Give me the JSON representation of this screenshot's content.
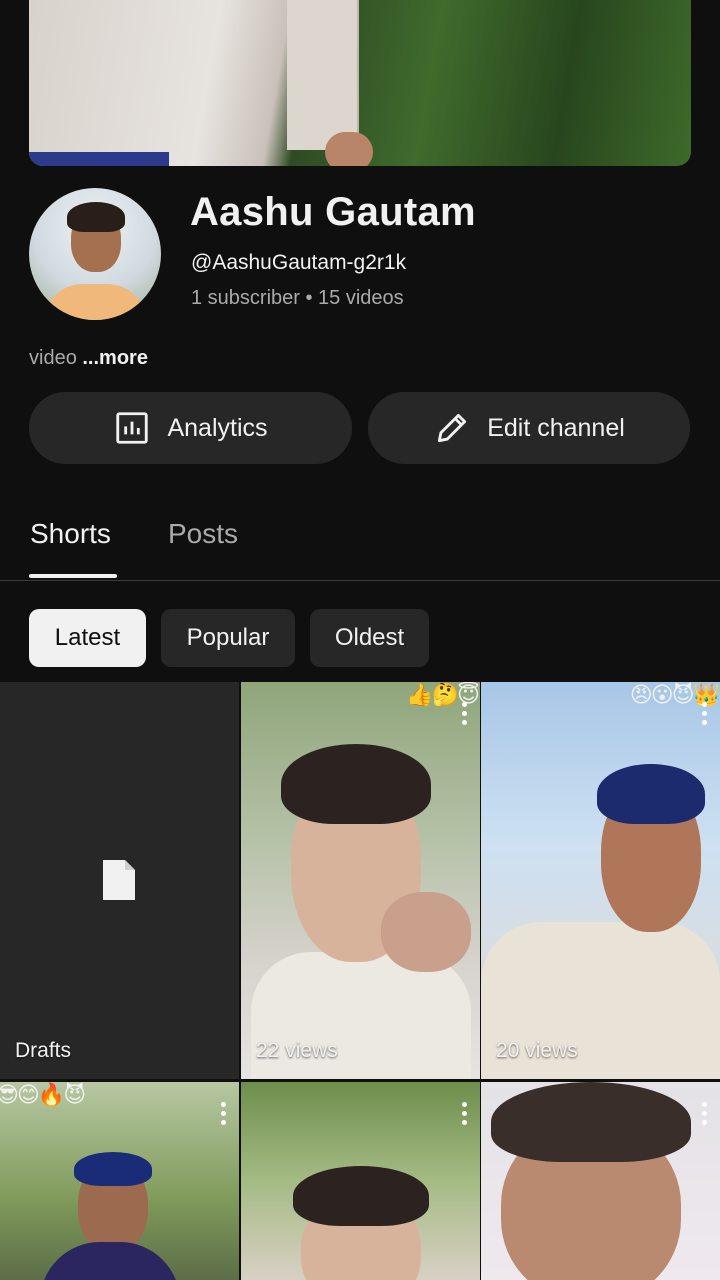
{
  "channel": {
    "name": "Aashu Gautam",
    "handle": "@AashuGautam-g2r1k",
    "stats": "1 subscriber • 15 videos",
    "description": "video",
    "more_label": "...more"
  },
  "actions": {
    "analytics_label": "Analytics",
    "edit_label": "Edit channel"
  },
  "tabs": [
    {
      "label": "Shorts",
      "selected": true
    },
    {
      "label": "Posts",
      "selected": false
    }
  ],
  "filters": [
    {
      "label": "Latest",
      "selected": true
    },
    {
      "label": "Popular",
      "selected": false
    },
    {
      "label": "Oldest",
      "selected": false
    }
  ],
  "grid": [
    {
      "type": "drafts",
      "label": "Drafts"
    },
    {
      "type": "short",
      "views": "22 views",
      "overlay": "👍🤔😇"
    },
    {
      "type": "short",
      "views": "20 views",
      "overlay": "😠😮😈👑"
    },
    {
      "type": "short",
      "views": "",
      "overlay": "😎😊🔥😈"
    },
    {
      "type": "short",
      "views": "",
      "overlay": ""
    },
    {
      "type": "short",
      "views": "",
      "overlay": ""
    }
  ],
  "colors": {
    "background": "#0f0f0f",
    "button_bg": "#272727",
    "chip_selected_bg": "#f1f1f1",
    "secondary_text": "#aaaaaa"
  }
}
